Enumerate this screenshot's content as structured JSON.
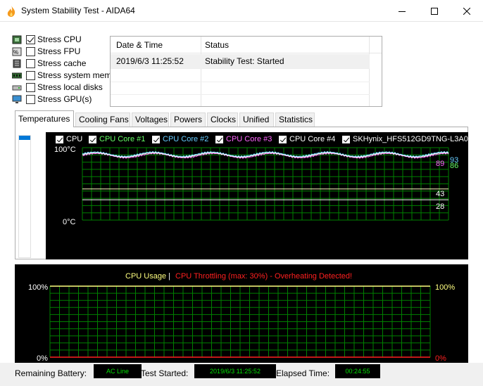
{
  "window": {
    "title": "System Stability Test - AIDA64",
    "minimize_icon": "minimize-icon",
    "maximize_icon": "maximize-icon",
    "close_icon": "close-icon"
  },
  "stress_options": [
    {
      "label": "Stress CPU",
      "checked": true,
      "icon": "cpu-icon"
    },
    {
      "label": "Stress FPU",
      "checked": false,
      "icon": "fpu-icon"
    },
    {
      "label": "Stress cache",
      "checked": false,
      "icon": "cache-icon"
    },
    {
      "label": "Stress system mem",
      "checked": false,
      "icon": "memory-icon"
    },
    {
      "label": "Stress local disks",
      "checked": false,
      "icon": "disk-icon"
    },
    {
      "label": "Stress GPU(s)",
      "checked": false,
      "icon": "monitor-icon"
    }
  ],
  "status_table": {
    "columns": [
      "Date & Time",
      "Status"
    ],
    "rows": [
      [
        "2019/6/3 11:25:52",
        "Stability Test: Started"
      ]
    ]
  },
  "tabs": [
    {
      "label": "Temperatures",
      "active": true
    },
    {
      "label": "Cooling Fans",
      "active": false
    },
    {
      "label": "Voltages",
      "active": false
    },
    {
      "label": "Powers",
      "active": false
    },
    {
      "label": "Clocks",
      "active": false
    },
    {
      "label": "Unified",
      "active": false
    },
    {
      "label": "Statistics",
      "active": false
    }
  ],
  "temperature_graph": {
    "legend": [
      {
        "label": "CPU",
        "color": "#ffffff"
      },
      {
        "label": "CPU Core #1",
        "color": "#66ff66"
      },
      {
        "label": "CPU Core #2",
        "color": "#66ccff"
      },
      {
        "label": "CPU Core #3",
        "color": "#ff66ff"
      },
      {
        "label": "CPU Core #4",
        "color": "#ffffff"
      },
      {
        "label": "SKHynix_HFS512GD9TNG-L3A0B",
        "color": "#ffffff"
      }
    ],
    "y_top_label": "100°C",
    "y_bottom_label": "0°C",
    "value_labels": [
      {
        "text": "93",
        "color": "#66ccff"
      },
      {
        "text": "89",
        "color": "#ff66ff"
      },
      {
        "text": "86",
        "color": "#66ff66"
      },
      {
        "text": "43",
        "color": "#ffffff"
      },
      {
        "text": "28",
        "color": "#ffffff"
      }
    ],
    "grid_color": "#008000"
  },
  "usage_graph": {
    "title_part1": "CPU Usage",
    "separator": "|",
    "title_part2": "CPU Throttling (max: 30%) - Overheating Detected!",
    "title_part1_color": "#ffff80",
    "title_part2_color": "#ff2020",
    "y_top_left": "100%",
    "y_bottom_left": "0%",
    "y_top_right": "100%",
    "y_bottom_right": "0%",
    "usage_value_percent": 100,
    "throttling_value_percent": 0
  },
  "status_bar": {
    "remaining_battery_label": "Remaining Battery:",
    "remaining_battery_value": "AC Line",
    "test_started_label": "Test Started:",
    "test_started_value": "2019/6/3 11:25:52",
    "elapsed_time_label": "Elapsed Time:",
    "elapsed_time_value": "00:24:55"
  }
}
